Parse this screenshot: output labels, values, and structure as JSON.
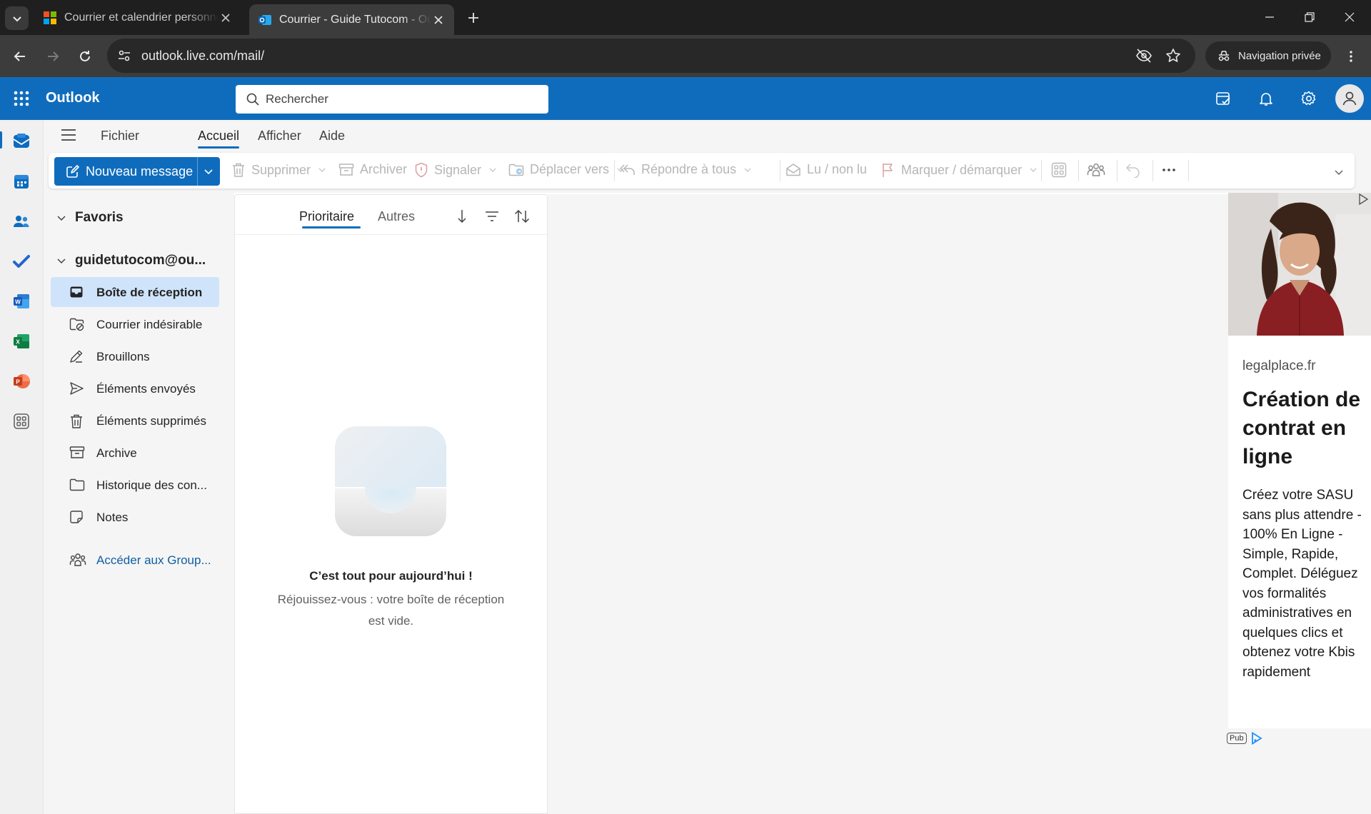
{
  "browser": {
    "tabs": [
      {
        "title": "Courrier et calendrier personnel Outlook",
        "active": false
      },
      {
        "title": "Courrier - Guide Tutocom - Outlook",
        "active": true
      }
    ],
    "url": "outlook.live.com/mail/",
    "private_label": "Navigation privée"
  },
  "outlook": {
    "app_name": "Outlook",
    "search_placeholder": "Rechercher",
    "accent_color": "#0f6cbd"
  },
  "menu": {
    "tabs": [
      "Fichier",
      "Accueil",
      "Afficher",
      "Aide"
    ],
    "active": "Accueil"
  },
  "ribbon": {
    "new_message": "Nouveau message",
    "delete": "Supprimer",
    "archive": "Archiver",
    "report": "Signaler",
    "move_to": "Déplacer vers",
    "reply_all": "Répondre à tous",
    "read_unread": "Lu / non lu",
    "flag": "Marquer / démarquer"
  },
  "folders": {
    "favorites_label": "Favoris",
    "account_label": "guidetutocom@ou...",
    "items": [
      {
        "label": "Boîte de réception",
        "icon": "inbox-icon",
        "selected": true
      },
      {
        "label": "Courrier indésirable",
        "icon": "junk-icon"
      },
      {
        "label": "Brouillons",
        "icon": "drafts-icon"
      },
      {
        "label": "Éléments envoyés",
        "icon": "sent-icon"
      },
      {
        "label": "Éléments supprimés",
        "icon": "trash-icon"
      },
      {
        "label": "Archive",
        "icon": "archive-icon"
      },
      {
        "label": "Historique des con...",
        "icon": "folder-icon"
      },
      {
        "label": "Notes",
        "icon": "notes-icon"
      }
    ],
    "groups_link": "Accéder aux Group..."
  },
  "message_list": {
    "tab_focused": "Prioritaire",
    "tab_other": "Autres",
    "empty_title": "C’est tout pour aujourd’hui !",
    "empty_subtitle": "Réjouissez-vous : votre boîte de réception est vide."
  },
  "ad": {
    "domain": "legalplace.fr",
    "title": "Création de contrat en ligne",
    "text": "Créez votre SASU sans plus attendre - 100% En Ligne - Simple, Rapide, Complet. Déléguez vos formalités administratives en quelques clics et obtenez votre Kbis rapidement",
    "badge": "Pub"
  }
}
